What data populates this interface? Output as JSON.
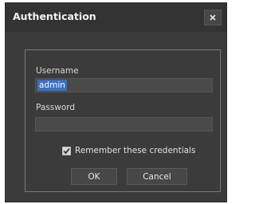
{
  "dialog": {
    "title": "Authentication",
    "close_icon": "close-icon"
  },
  "form": {
    "username_label": "Username",
    "username_value": "admin",
    "password_label": "Password",
    "password_value": "",
    "remember_label": "Remember these credentials",
    "remember_checked": true,
    "ok_label": "OK",
    "cancel_label": "Cancel"
  },
  "colors": {
    "dialog_bg": "#3b3b3b",
    "title_text": "#f2f2f2",
    "selection": "#3b6fc4"
  }
}
